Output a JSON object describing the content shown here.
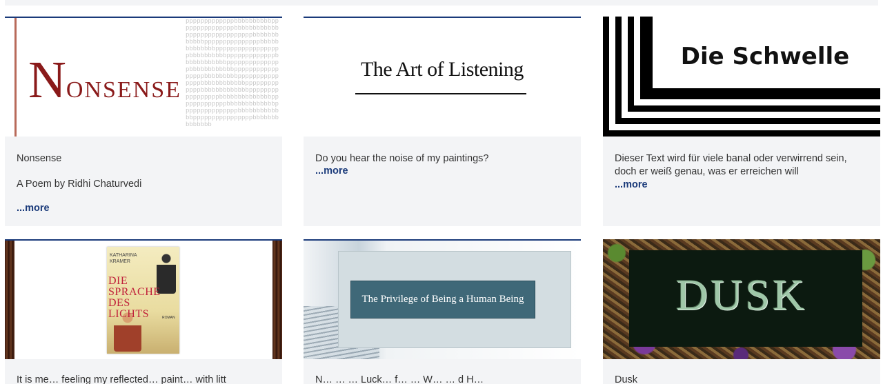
{
  "cards": [
    {
      "image_text": {
        "big": "N",
        "rest": "ONSENSE",
        "pattern": "pppppppppppppbbbbbbbbbbpppppppppppppppbbbbbbbbbbbbppppppppppppppppppbbbbbbbbbbbbpppppppppppppppbbbbbbbbbbbbbppppppppppppppppppbbbbbbbbbbpppppppppppppbbbbbbbbbbbbpppppppppppppppbbbbbbbbbbbbpppppppppppppppppbbbbbbbbbpppppppppppppppbbbbbbbbbbbbpppppppppppppbbbbbbbbbbbbbpppppppppppppppppbbbbbbbbbbbbbbpppppppppppppbbbbbbbbbbbbbpppppppppppppppbbbbbbbbbbbbbppppppppppppppppbbbbbbbbbbbbbb"
      },
      "title": "Nonsense",
      "subtitle": "A Poem by Ridhi Chaturvedi",
      "more": "...more"
    },
    {
      "image_text": {
        "title": "The Art of Listening"
      },
      "title": "Do you hear the noise of my paintings?",
      "more": "...more"
    },
    {
      "image_text": {
        "title": "Die Schwelle"
      },
      "title_line1": "Dieser Text wird für viele banal oder verwirrend sein,",
      "title_line2": "doch er weiß genau, was er erreichen will",
      "more": "...more"
    },
    {
      "image_text": {
        "author1": "KATHARINA",
        "author2": "KRAMER",
        "title": "DIE SPRACHE DES LICHTS",
        "genre": "ROMAN"
      },
      "title": "It is me… feeling my reflected… paint… with litt"
    },
    {
      "image_text": {
        "title": "The Privilege of Being a Human Being"
      },
      "title": "N… … … Luck… f… … W… … d H…"
    },
    {
      "image_text": {
        "title": "DUSK"
      },
      "title": "Dusk"
    }
  ]
}
